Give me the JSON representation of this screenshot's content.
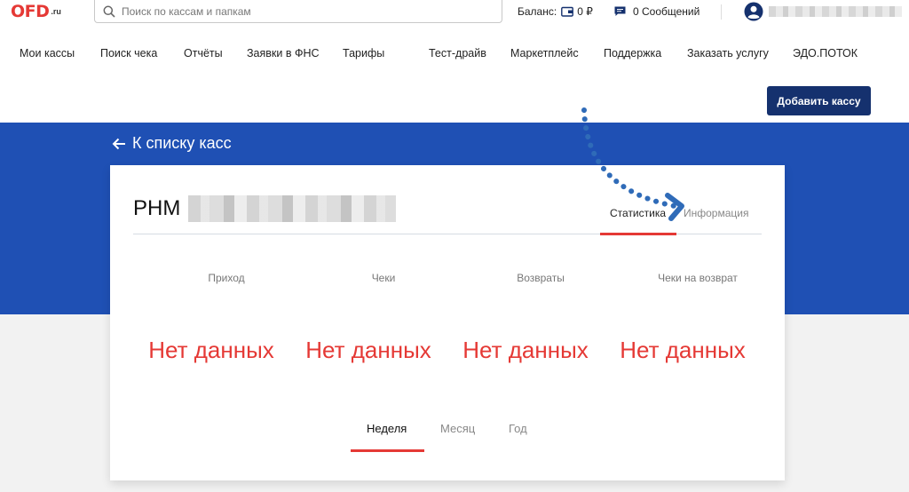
{
  "header": {
    "logo_main": "OFD",
    "logo_sub": ".ru",
    "search_placeholder": "Поиск по кассам и папкам",
    "balance_label": "Баланс:",
    "balance_value": "0 ₽",
    "messages": "0 Сообщений"
  },
  "nav": {
    "items": [
      "Мои кассы",
      "Поиск чека",
      "Отчёты",
      "Заявки в ФНС",
      "Тарифы",
      "Тест-драйв",
      "Маркетплейс",
      "Поддержка",
      "Заказать услугу",
      "ЭДО.ПОТОК"
    ],
    "add_button": "Добавить кассу"
  },
  "back_link": "К списку касс",
  "card": {
    "title": "РНМ",
    "tabs": [
      {
        "label": "Статистика",
        "active": true
      },
      {
        "label": "Информация",
        "active": false
      }
    ],
    "stats": [
      {
        "label": "Приход",
        "value": "Нет данных"
      },
      {
        "label": "Чеки",
        "value": "Нет данных"
      },
      {
        "label": "Возвраты",
        "value": "Нет данных"
      },
      {
        "label": "Чеки на возврат",
        "value": "Нет данных"
      }
    ],
    "periods": [
      {
        "label": "Неделя",
        "active": true
      },
      {
        "label": "Месяц",
        "active": false
      },
      {
        "label": "Год",
        "active": false
      }
    ]
  },
  "colors": {
    "accent": "#e53935",
    "brand_blue": "#1f50b4",
    "button_navy": "#15316e",
    "annotation_arrow": "#2f6bb8"
  }
}
